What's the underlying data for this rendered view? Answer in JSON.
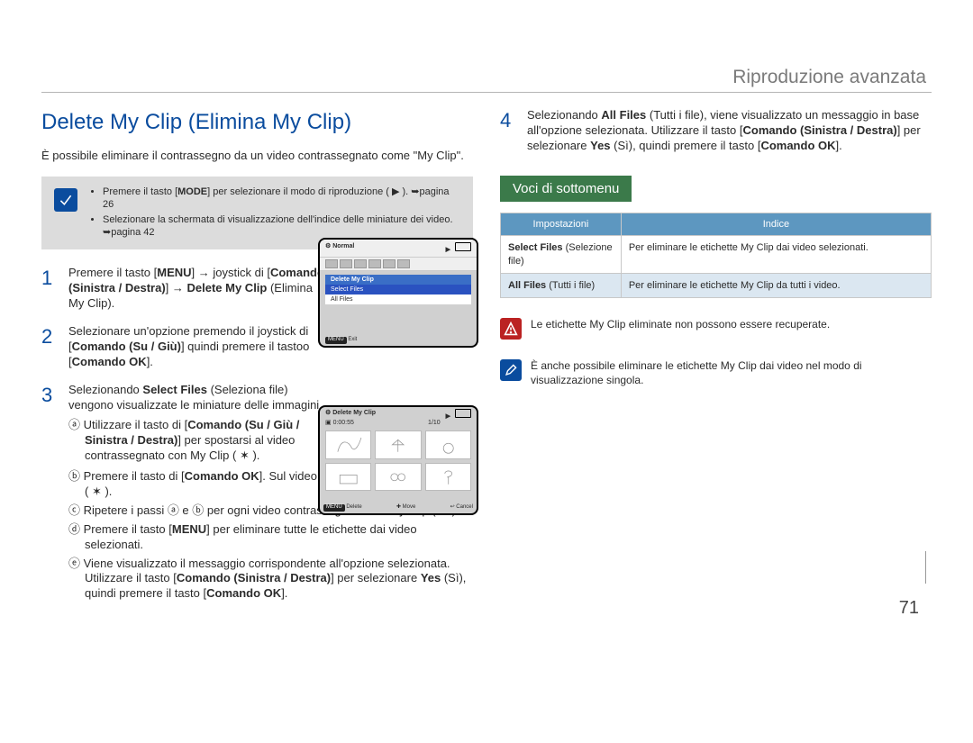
{
  "breadcrumb": "Riproduzione avanzata",
  "page_number": "71",
  "left": {
    "title": "Delete My Clip (Elimina My Clip)",
    "intro": "È possibile eliminare il contrassegno da un video contrassegnato come \"My Clip\".",
    "callout": {
      "item1_a": "Premere il tasto [",
      "item1_mode": "MODE",
      "item1_b": "] per selezionare il modo di riproduzione ( ▶ ). ",
      "item1_ref": "➥pagina 26",
      "item2_a": "Selezionare la schermata di visualizzazione dell'indice delle miniature dei video. ",
      "item2_ref": "➥pagina 42"
    },
    "steps": {
      "s1_a": "Premere il tasto [",
      "s1_menu": "MENU",
      "s1_b": "] → joystick di [",
      "s1_cmd1": "Comando (Sinistra / Destra)",
      "s1_c": "] → ",
      "s1_bold2": "Delete My Clip",
      "s1_d": " (Elimina My Clip).",
      "s2_a": "Selezionare un'opzione premendo il joystick di [",
      "s2_cmd": "Comando (Su / Giù)",
      "s2_b": "] quindi premere il tastoo [",
      "s2_ok": "Comando OK",
      "s2_c": "].",
      "s3_a": "Selezionando ",
      "s3_b": "Select Files",
      "s3_c": " (Seleziona file) vengono visualizzate le miniature delle immagini.",
      "s3_sub_a_1": "ⓐ Utilizzare il tasto di [",
      "s3_sub_a_b": "Comando (Su / Giù / Sinistra / Destra)",
      "s3_sub_a_2": "] per spostarsi al video contrassegnato con My Clip ( ✶ ).",
      "s3_sub_b_1": "ⓑ Premere il tasto di [",
      "s3_sub_b_b": "Comando OK",
      "s3_sub_b_2": "]. Sul video compare l'icona con il cestino ( ✶ ).",
      "s3_sub_c": "ⓒ Ripetere i passi ⓐ e ⓑ per ogni video contrassegnato con My Clip ( ✶ ).",
      "s3_sub_d_1": "ⓓ Premere il tasto [",
      "s3_sub_d_b": "MENU",
      "s3_sub_d_2": "] per eliminare tutte le etichette dai video selezionati.",
      "s3_sub_e_1": "ⓔ Viene visualizzato il messaggio corrispondente all'opzione selezionata. Utilizzare il tasto [",
      "s3_sub_e_b1": "Comando (Sinistra / Destra)",
      "s3_sub_e_2": "] per selezionare ",
      "s3_sub_e_b2": "Yes",
      "s3_sub_e_3": " (Sì), quindi premere il tasto [",
      "s3_sub_e_b3": "Comando OK",
      "s3_sub_e_4": "]."
    },
    "screenA": {
      "top": "Normal",
      "menu_header": "Delete My Clip",
      "menu_sel": "Select Files",
      "menu_all": "All Files",
      "foot_menu": "MENU",
      "foot_exit": "Exit"
    },
    "screenB": {
      "title": "Delete My Clip",
      "time": "0:00:55",
      "counter": "1/10",
      "f_menu": "MENU",
      "f_del": "Delete",
      "f_mid": "Move",
      "f_cancel": "Cancel"
    }
  },
  "right": {
    "step4_a": "Selezionando ",
    "step4_b1": "All Files",
    "step4_b": " (Tutti i file), viene visualizzato un messaggio in base all'opzione selezionata. Utilizzare il tasto [",
    "step4_cmd1": "Comando (Sinistra / Destra)",
    "step4_c": "] per selezionare ",
    "step4_yes": "Yes",
    "step4_d": " (Sì), quindi premere il tasto [",
    "step4_cmd2": "Comando OK",
    "step4_e": "].",
    "subhead": "Voci di sottomenu",
    "table": {
      "h1": "Impostazioni",
      "h2": "Indice",
      "r1c1a": "Select Files",
      "r1c1b": " (Selezione file)",
      "r1c2": "Per eliminare le etichette My Clip dai video selezionati.",
      "r2c1a": "All Files",
      "r2c1b": " (Tutti i file)",
      "r2c2": "Per eliminare le etichette My Clip da tutti i video."
    },
    "warn": "Le etichette My Clip eliminate non possono essere recuperate.",
    "tip": "È anche possibile eliminare le etichette My Clip dai video nel modo di visualizzazione singola."
  }
}
